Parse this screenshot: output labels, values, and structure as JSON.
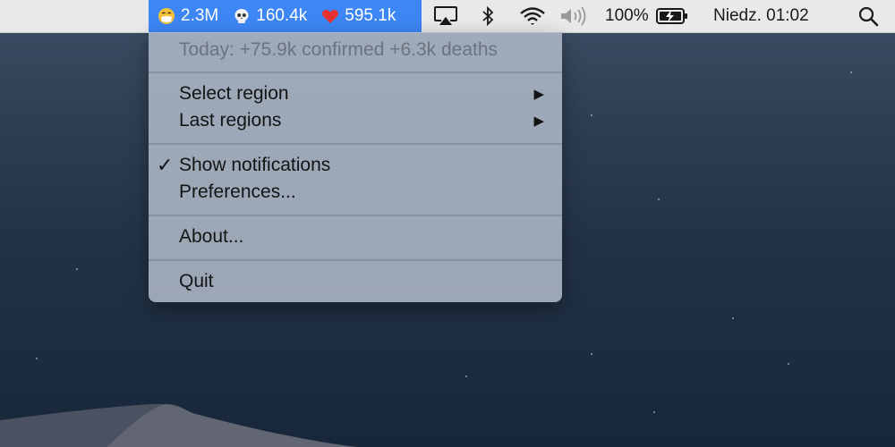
{
  "menubar": {
    "status": {
      "confirmed_icon": "mask-emoji",
      "confirmed": "2.3M",
      "deaths_icon": "skull-emoji",
      "deaths": "160.4k",
      "recovered_icon": "heart-emoji",
      "recovered": "595.1k",
      "highlight_color": "#3d86f5"
    },
    "icons": [
      "airplay-icon",
      "bluetooth-icon",
      "wifi-icon",
      "volume-icon",
      "battery-charging-icon",
      "spotlight-search-icon"
    ],
    "battery_percent": "100%",
    "clock": "Niedz. 01:02"
  },
  "menu": {
    "today_summary": "Today: +75.9k confirmed +6.3k deaths",
    "select_region": "Select region",
    "last_regions": "Last regions",
    "show_notifications": "Show notifications",
    "show_notifications_checked": true,
    "preferences": "Preferences...",
    "about": "About...",
    "quit": "Quit"
  }
}
